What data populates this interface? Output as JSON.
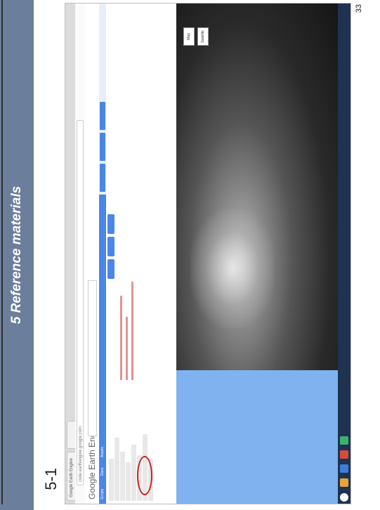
{
  "slide": {
    "title": "5 Reference materials",
    "section_number": "5-1",
    "page_number": "33"
  },
  "screenshot": {
    "app_logo": "Google Earth Engine",
    "browser_tab_1": "Google Earth Engine",
    "address": "code.earthengine.google.com",
    "panel_tabs": [
      "Scripts",
      "Docs",
      "Assets"
    ],
    "map_controls": [
      "Map",
      "Satellite"
    ],
    "annotation_color": "#cc1f1f",
    "map_water_color": "#7fb2ee",
    "accent_color": "#4a86e8"
  }
}
